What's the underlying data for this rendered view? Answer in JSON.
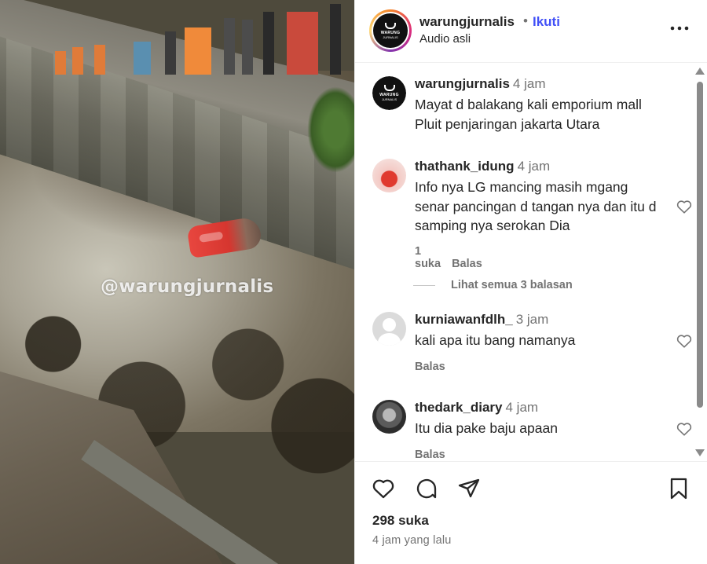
{
  "media": {
    "watermark": "@warungjurnalis"
  },
  "header": {
    "username": "warungjurnalis",
    "separator": "•",
    "follow_label": "Ikuti",
    "audio_label": "Audio asli",
    "more_icon": "more-horizontal-icon",
    "avatar_text_line1": "WARUNG",
    "avatar_text_line2": "JURNALIS"
  },
  "caption": {
    "username": "warungjurnalis",
    "time": "4 jam",
    "text": "Mayat d balakang kali emporium mall Pluit penjaringan jakarta Utara"
  },
  "comments": [
    {
      "username": "thathank_idung",
      "time": "4 jam",
      "text": "Info nya LG mancing masih mgang senar pancingan d tangan nya dan itu d samping nya serokan Dia",
      "likes_label": "1 suka",
      "reply_label": "Balas",
      "view_replies": "Lihat semua 3 balasan"
    },
    {
      "username": "kurniawanfdlh_",
      "time": "3 jam",
      "text": "kali apa itu bang namanya",
      "reply_label": "Balas"
    },
    {
      "username": "thedark_diary",
      "time": "4 jam",
      "text": "Itu dia pake baju apaan",
      "reply_label": "Balas"
    }
  ],
  "footer": {
    "likes": "298 suka",
    "posted": "4 jam yang lalu"
  },
  "colors": {
    "follow": "#4150f7",
    "muted": "#737373",
    "text": "#262626"
  }
}
